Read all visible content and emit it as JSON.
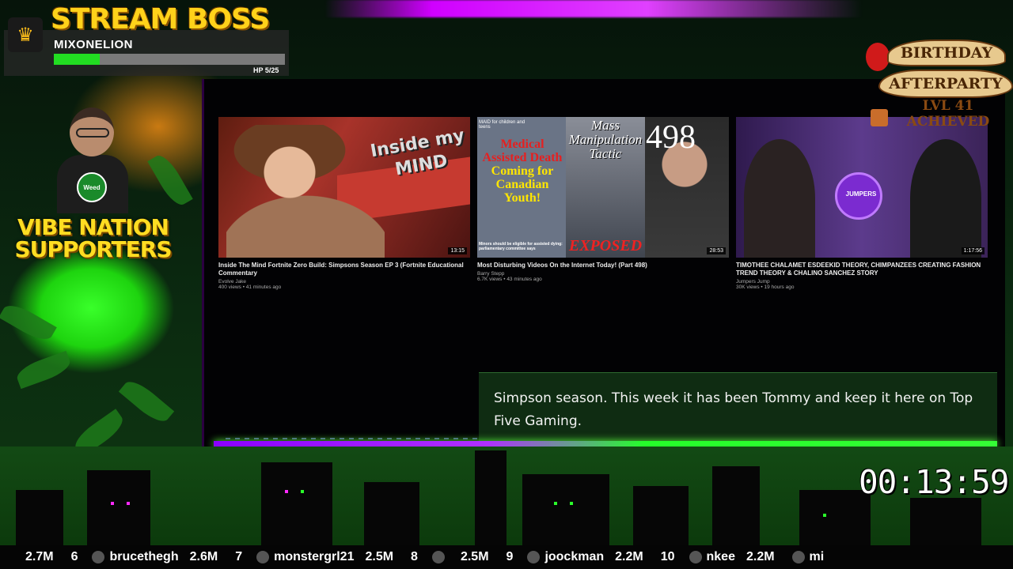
{
  "stream_boss": {
    "title": "STREAM BOSS",
    "name": "MIXONELION",
    "hp_text": "HP 5/25",
    "hp_fraction": 0.2,
    "colors": {
      "title": "#ffd21a",
      "hp_fill": "#22dd22"
    }
  },
  "supporters_title": "VIBE NATION SUPPORTERS",
  "avatar": {
    "badge_text": "Weed"
  },
  "birthday": {
    "line1": "BIRTHDAY",
    "line2": "AFTERPARTY",
    "line3": "LVL 41",
    "line4": "ACHIEVED"
  },
  "videos": [
    {
      "thumb_text": "Inside my MIND",
      "duration": "13:15",
      "title": "Inside The Mind Fortnite Zero Build: Simpsons Season EP 3 (Fortnite Educational Commentary",
      "channel": "Evolve Jake",
      "meta": "400 views • 41 minutes ago"
    },
    {
      "thumb_maid": "MAID for children and teens",
      "thumb_red": "Medical Assisted Death",
      "thumb_yellow": "Coming for Canadian Youth!",
      "thumb_mass": "Mass Manipulation Tactic",
      "thumb_num": "498",
      "thumb_exposed": "EXPOSED",
      "thumb_small": "Minors should be eligible for assisted dying: parliamentary committee says",
      "duration": "28:53",
      "title": "Most Disturbing Videos On the Internet Today! (Part 498)",
      "channel": "Barry Stepp",
      "meta": "6.7K views • 43 minutes ago"
    },
    {
      "thumb_logo": "JUMPERS",
      "duration": "1:17:56",
      "title": "TIMOTHEE CHALAMET ESDEEKID THEORY, CHIMPANZEES CREATING FASHION TREND THEORY & CHALINO SANCHEZ STORY",
      "channel": "Jumpers Jump",
      "meta": "30K views • 19 hours ago"
    }
  ],
  "caption": "Simpson season. This week it has been Tommy and keep it here on Top Five Gaming.",
  "timer": "00:13:59",
  "leaderboard": [
    {
      "rank": "",
      "name": "",
      "value": "2.7M"
    },
    {
      "rank": "6",
      "name": "brucethegh",
      "value": "2.6M"
    },
    {
      "rank": "7",
      "name": "monstergrl21",
      "value": "2.5M"
    },
    {
      "rank": "8",
      "name": "",
      "value": "2.5M"
    },
    {
      "rank": "9",
      "name": "joockman",
      "value": "2.2M"
    },
    {
      "rank": "10",
      "name": "nkee",
      "value": "2.2M"
    },
    {
      "rank": "",
      "name": "mi",
      "value": ""
    }
  ]
}
